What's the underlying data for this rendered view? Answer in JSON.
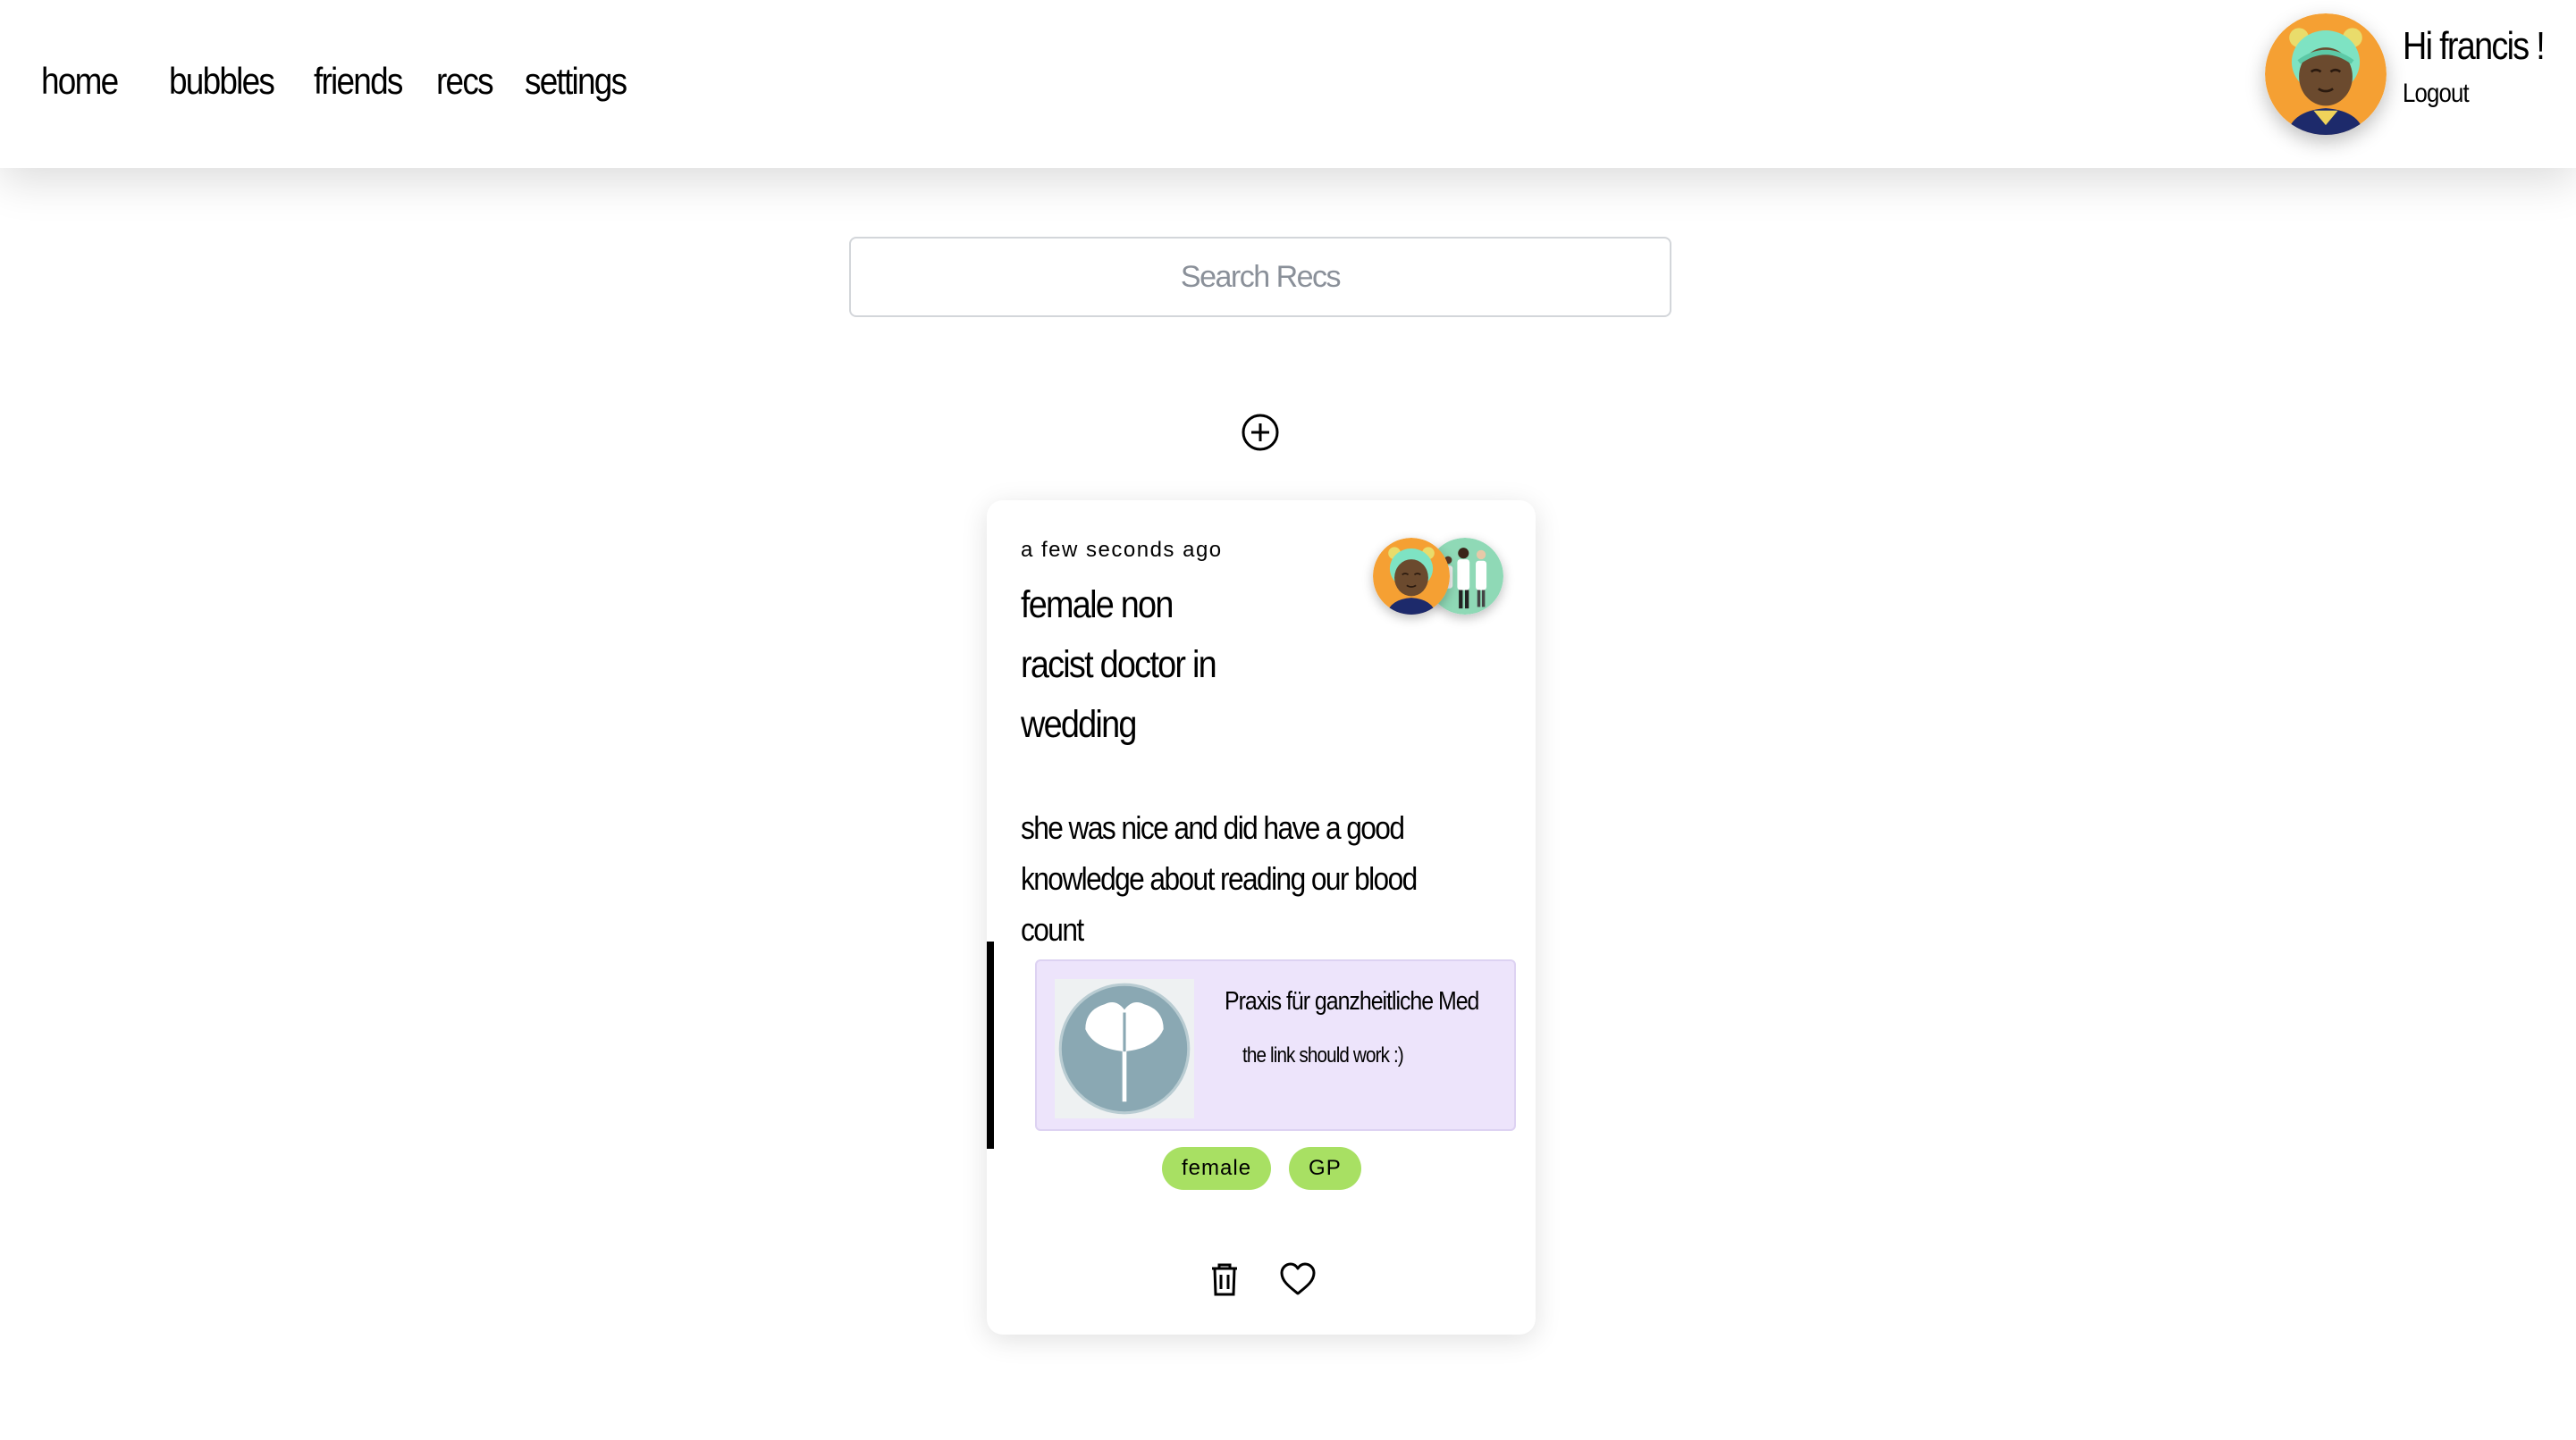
{
  "nav": {
    "items": [
      {
        "label": "home"
      },
      {
        "label": "bubbles"
      },
      {
        "label": "friends"
      },
      {
        "label": "recs"
      },
      {
        "label": "settings"
      }
    ]
  },
  "user": {
    "greeting": "Hi francis !",
    "logout_label": "Logout",
    "avatar_icon": "avatar-bear-hood-icon"
  },
  "search": {
    "placeholder": "Search Recs",
    "value": ""
  },
  "add_button_icon": "plus-circle-icon",
  "rec": {
    "timestamp": "a few seconds ago",
    "title": "female non racist doctor in wedding",
    "description": "she was nice and did have a good knowledge about reading our blood count",
    "link": {
      "title": "Praxis für ganzheitliche Medi…",
      "description": "the link should work :)",
      "thumbnail_icon": "ginkgo-leaf-logo-icon"
    },
    "tags": [
      "female",
      "GP"
    ],
    "actions": {
      "delete_icon": "trash-icon",
      "like_icon": "heart-icon"
    }
  },
  "colors": {
    "tag_bg": "#a8e063",
    "link_preview_bg": "#ede4fb",
    "avatar_orange": "#f5a033",
    "avatar_green": "#8fd9b6"
  }
}
